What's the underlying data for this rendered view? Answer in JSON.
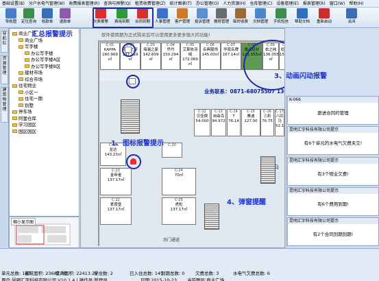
{
  "menubar": [
    "基础设置(B)",
    "分户水电气管理(W)",
    "收费报表管理(R)",
    "查询与预警(Q)",
    "租赁收费管理(Z)",
    "统计图表(T)",
    "办公管理(O)",
    "人力资源(H)",
    "仓库管理(C)",
    "设备管理(E)",
    "报表管理(R)",
    "窗口(W)",
    "帮助(H)"
  ],
  "toolbar": [
    {
      "label": "导航图",
      "icon": "navigation-map-icon",
      "color": "#4a7fc8"
    },
    {
      "label": "定位查询",
      "icon": "locate-search-icon",
      "color": "#3c8f48"
    },
    {
      "label": "收款单",
      "icon": "receipt-icon",
      "color": "#3b6fb5"
    },
    {
      "label": "退款单",
      "icon": "refund-icon",
      "color": "#8b5bb0"
    },
    {
      "label": "欠费报警",
      "icon": "arrears-alarm-icon",
      "color": "#d63030"
    },
    {
      "label": "费用到期",
      "icon": "fee-expiry-icon",
      "color": "#2f9a3c"
    },
    {
      "label": "合同到期",
      "icon": "contract-expiry-icon",
      "color": "#d63030"
    },
    {
      "label": "人事管理",
      "icon": "personnel-icon",
      "color": "#3c72c4"
    },
    {
      "label": "客户管理",
      "icon": "customer-icon",
      "color": "#cf7a2a"
    },
    {
      "label": "投诉管理",
      "icon": "complaint-icon",
      "color": "#5a8fd0"
    },
    {
      "label": "报修管理",
      "icon": "repair-icon",
      "color": "#6b6b6b"
    },
    {
      "label": "临时收费",
      "icon": "temp-fee-icon",
      "color": "#9a6a3a"
    },
    {
      "label": "文档管理",
      "icon": "document-icon",
      "color": "#4a86c8"
    },
    {
      "label": "手机短信",
      "icon": "sms-icon",
      "color": "#3c8f48"
    },
    {
      "label": "帮助文档",
      "icon": "help-icon",
      "color": "#2e6fc0"
    },
    {
      "label": "重新启动",
      "icon": "restart-icon",
      "color": "#c82e2e"
    },
    {
      "label": "关闭",
      "icon": "close-icon",
      "color": "#3c6fb0"
    }
  ],
  "sidetabs": [
    "导航栏",
    "资源管理",
    "建筑物管理"
  ],
  "tree": [
    {
      "label": "商业广场",
      "level": 0
    },
    {
      "label": "商业广场",
      "level": 1
    },
    {
      "label": "写字楼",
      "level": 1
    },
    {
      "label": "办公写字楼",
      "level": 2
    },
    {
      "label": "办公写字楼A区",
      "level": 2
    },
    {
      "label": "办公写字楼B区",
      "level": 2
    },
    {
      "label": "建材市场",
      "level": 1
    },
    {
      "label": "综合市场",
      "level": 1
    },
    {
      "label": "住宅物业",
      "level": 0
    },
    {
      "label": "小区一",
      "level": 1
    },
    {
      "label": "住宅一期",
      "level": 1
    },
    {
      "label": "别墅",
      "level": 1
    },
    {
      "label": "停车场",
      "level": 0
    },
    {
      "label": "阿里仓库",
      "level": 0
    },
    {
      "label": "学习园区",
      "level": 0
    },
    {
      "label": "园区园区",
      "level": 0
    }
  ],
  "minimap_title": "缩小显示图",
  "floorplan": {
    "notice": "软件使用期为正式购买后可以使用更多更多强大的功能!",
    "top_shops": [
      {
        "code": "C-01",
        "name": "KAPPA",
        "area": "160.909㎡"
      },
      {
        "code": "C-02",
        "name": "海澜之家",
        "area": "137.119㎡"
      },
      {
        "code": "C-03",
        "name": "海澜之家",
        "area": "142.609㎡"
      },
      {
        "code": "C-04",
        "name": "乔丹",
        "area": "150.294㎡"
      },
      {
        "code": "C-05",
        "name": "艾莱依羽绒",
        "area": "172.069㎡"
      },
      {
        "code": "C-06",
        "name": "名典服饰",
        "area": "145.00㎡"
      },
      {
        "code": "C-07",
        "name": "华南名牌",
        "area": "167.14㎡"
      },
      {
        "code": "C-08",
        "name": "逸品佳什",
        "area": "123.355㎡"
      },
      {
        "code": "C-09",
        "name": "衣之纯",
        "area": "136.055㎡"
      },
      {
        "code": "C-10",
        "name": "班尼路",
        "area": "150.985㎡"
      }
    ],
    "contact": "业务联系：0871-68075507 13033340505",
    "mid_shops": [
      {
        "code": "C-12",
        "name": "贝佳倒",
        "area": "54.000"
      },
      {
        "code": "C-13",
        "name": "自由鸟",
        "area": "94.972"
      },
      {
        "code": "C-14",
        "name": "T",
        "area": "76.14"
      },
      {
        "code": "C-15",
        "name": "雅迪",
        "area": "127.00"
      },
      {
        "code": "C-16",
        "name": "三彩",
        "area": "76.75"
      },
      {
        "code": "C-17",
        "name": "八匹马",
        "area": "52.18"
      }
    ],
    "lower_shops": [
      {
        "code": "C-19",
        "name": "龙达",
        "area": "143.23㎡"
      },
      {
        "code": "C-20",
        "name": "",
        "area": ""
      },
      {
        "code": "C-23",
        "name": "金帝雀",
        "area": "137.17㎡"
      },
      {
        "code": "C-24",
        "name": "",
        "area": "70㎡"
      },
      {
        "code": "C-22",
        "name": "爱度堡",
        "area": "137.17㎡"
      },
      {
        "code": "C-25",
        "name": "虎彪",
        "area": "137.17㎡"
      }
    ],
    "corridor_label": "通道",
    "bottom_label": "后门通道",
    "right_label": "马"
  },
  "annotations": {
    "summary": "汇总报警提示",
    "icon_alarm": "1、图标报警提示",
    "anim_alarm": "3、动画闪动报警",
    "popup": "4、弹窗提醒"
  },
  "alerts": [
    {
      "title": "K-066",
      "body": "跟进合同的管理"
    },
    {
      "title": "昆明汇宇科技有限公司提示",
      "body": "有6个单元的水电气欠费未交!"
    },
    {
      "title": "昆明汇宇科技有限公司提示",
      "body": "有3个物业欠费!"
    },
    {
      "title": "昆明汇宇科技有限公司提示",
      "body": "有6个费用到期!"
    },
    {
      "title": "昆明汇宇科技有限公司提示",
      "body": "有2个合同到期到期!"
    }
  ],
  "statusbar": {
    "row1": [
      "单元总数: 147",
      "建筑面积: 23687.89",
      "套内面积: 22413.28",
      "空住数: 2",
      "已入住总数: 145",
      "到期总数: 0",
      "欠费总数: 3",
      "水电气欠费总数: 6"
    ],
    "row2": [
      "用户:昆明汇宇科技有限公司 V10.1.4 | 操作员:管理员",
      "日期:2015-10-23",
      "当前图层:商业广场"
    ]
  }
}
